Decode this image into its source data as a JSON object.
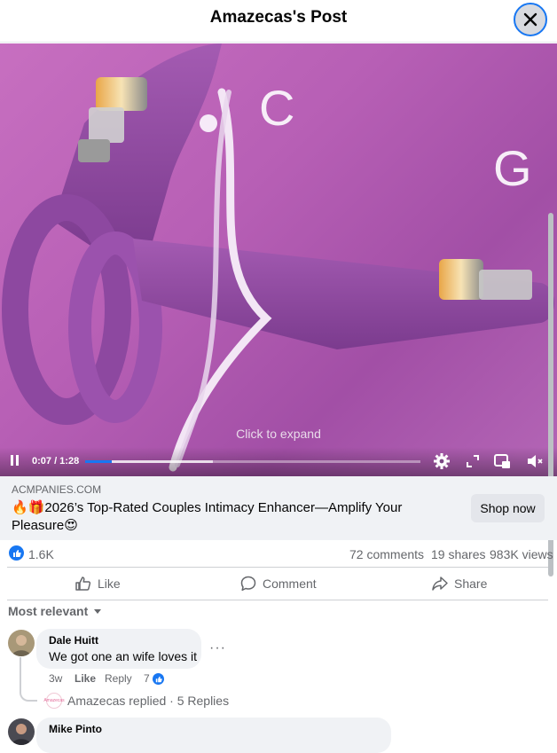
{
  "header": {
    "title": "Amazecas's Post",
    "close_icon": "close-icon"
  },
  "video": {
    "letter_c": "C",
    "letter_g": "G",
    "expand_hint": "Click to expand",
    "time": "0:07 / 1:28",
    "progress_fraction": 0.08,
    "buffer_fraction": 0.38,
    "icons": [
      "pause-icon",
      "gear-icon",
      "fullscreen-icon",
      "picture-in-picture-icon",
      "mute-icon"
    ]
  },
  "link": {
    "domain": "ACMPANIES.COM",
    "title": "🔥🎁2026’s Top-Rated Couples Intimacy Enhancer—Amplify Your Pleasure😍",
    "cta": "Shop now"
  },
  "stats": {
    "likes": "1.6K",
    "comments": "72 comments",
    "shares": "19 shares",
    "views": "983K views"
  },
  "actions": {
    "like": "Like",
    "comment": "Comment",
    "share": "Share"
  },
  "sort": {
    "label": "Most relevant"
  },
  "comments": [
    {
      "name": "Dale Huitt",
      "text": "We got one an wife loves it",
      "time": "3w",
      "like": "Like",
      "reply": "Reply",
      "reactions": "7",
      "replies_summary": "Amazecas replied · 5 Replies",
      "reply_avatar_text": "Amazecas"
    },
    {
      "name": "Mike Pinto"
    }
  ],
  "colors": {
    "accent": "#1877f2",
    "video_bg": "#b866b7",
    "card_bg": "#f0f2f5"
  }
}
